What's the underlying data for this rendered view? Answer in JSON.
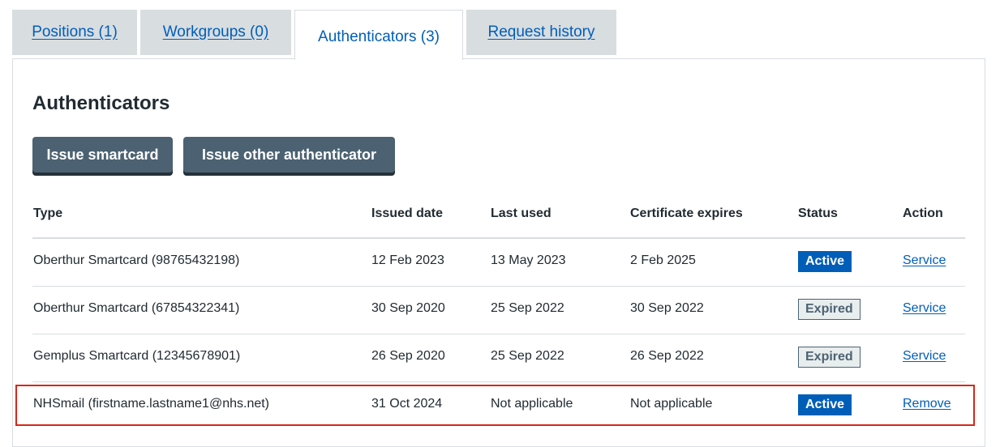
{
  "tabs": {
    "positions": "Positions (1)",
    "workgroups": "Workgroups (0)",
    "authenticators": "Authenticators (3)",
    "request_history": "Request history"
  },
  "main": {
    "heading": "Authenticators",
    "issue_smartcard_label": "Issue smartcard",
    "issue_other_label": "Issue other authenticator"
  },
  "table": {
    "headers": {
      "type": "Type",
      "issued": "Issued date",
      "last_used": "Last used",
      "cert_expires": "Certificate expires",
      "status": "Status",
      "action": "Action"
    },
    "rows": [
      {
        "type": "Oberthur Smartcard (98765432198)",
        "issued": "12 Feb 2023",
        "last_used": "13 May 2023",
        "cert_expires": "2 Feb 2025",
        "status": "Active",
        "action": "Service"
      },
      {
        "type": "Oberthur Smartcard (67854322341)",
        "issued": "30 Sep 2020",
        "last_used": "25 Sep 2022",
        "cert_expires": "30 Sep 2022",
        "status": "Expired",
        "action": "Service"
      },
      {
        "type": "Gemplus Smartcard (12345678901)",
        "issued": "26 Sep 2020",
        "last_used": "25 Sep 2022",
        "cert_expires": "26 Sep 2022",
        "status": "Expired",
        "action": "Service"
      },
      {
        "type": "NHSmail (firstname.lastname1@nhs.net)",
        "issued": "31 Oct 2024",
        "last_used": "Not applicable",
        "cert_expires": "Not applicable",
        "status": "Active",
        "action": "Remove"
      }
    ]
  },
  "colors": {
    "link": "#005eb8",
    "active_tag": "#005eb8",
    "expired_tag_bg": "#e8edee",
    "button": "#4c6272",
    "highlight": "#d5281b"
  }
}
